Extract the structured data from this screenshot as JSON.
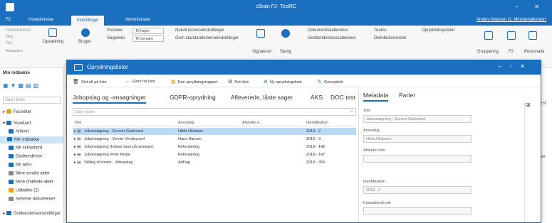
{
  "app": {
    "title": "cBrain F2- TestRC",
    "user": "Anders Madsen (1. Ministerialkontor)"
  },
  "menubar": [
    "F2",
    "Hovedvindue",
    "Indstillinger",
    "Administrator"
  ],
  "ribbon": {
    "left_items": [
      "Hovedvindue",
      "Skp.",
      "Akt."
    ],
    "navigation_label": "Navigation",
    "buttons": [
      "Opsætning",
      "Bruger"
    ],
    "preview_label": "Preview:",
    "preview_value": "Til højre",
    "search_label": "Søgeliste:",
    "search_value": "Til venstre",
    "options": [
      "Nulstil kolonneindstillinger",
      "Gem standardkolonneindstillinger"
    ],
    "signatures": "Signaturer",
    "language": "Sprog",
    "dokument": [
      "Dokumentskabeloner",
      "Godkendelsesskabeloner"
    ],
    "teams": [
      "Teams",
      "Distributionslister"
    ],
    "opr": "Opryddningslister",
    "right": [
      "Gruppering",
      "F2",
      "Personalia"
    ]
  },
  "sidebar": {
    "top": "Min indbakke",
    "search_placeholder": "Søg i lister",
    "favorites": "Favoritter",
    "standard": "Standard",
    "items": [
      "Arkivet",
      "Min indbakke",
      "Mit skrivebord",
      "Godkendelser",
      "Mit arkiv",
      "Mine sendte akter",
      "Mine chattede akter",
      "Udbakke (1)",
      "Seneste dokumenter"
    ],
    "last": "Godkendelseshandlinger"
  },
  "modal": {
    "title": "Oprydningslister",
    "toolbar": [
      "Slet alt på liste",
      "Fjern fra liste",
      "Dan oprydningsrapport",
      "Ret liste",
      "Ny oprydningsliste",
      "Genoptrisk"
    ],
    "tabs": [
      "Jobopslag og -ansøgninger",
      "GDPR-oprydning",
      "Afleverede, låste sager",
      "AKS",
      "DOC test"
    ],
    "search_placeholder": "Søg i listen",
    "columns": [
      "Titel",
      "Ansvarlig",
      "Afsluttet d.",
      "Identifikation"
    ],
    "rows": [
      {
        "title": "Jobansøgning - Gunvor Gudmund",
        "owner": "Hilda Hildasen",
        "closed": "",
        "id": "2019 - 2"
      },
      {
        "title": "Jobansøgning - Verner Vendsyssel",
        "owner": "Hans Hansen",
        "closed": "",
        "id": "2019 - 3"
      },
      {
        "title": "Jobansøgning (Indsat navn på ansøger)",
        "owner": "Rekruttering",
        "closed": "",
        "id": "2019 - 142"
      },
      {
        "title": "Jobansøgning Peter Pedal",
        "owner": "Rekruttering",
        "closed": "",
        "id": "2019 - 147"
      },
      {
        "title": "Stilling til kontor - Jobopslag",
        "owner": "AdDep",
        "closed": "",
        "id": "2019 - 356"
      }
    ],
    "right_tabs": [
      "Metadata",
      "Parter"
    ],
    "fields": [
      {
        "label": "Titel",
        "value": "Jobansøgning - Gunvor Gudmund"
      },
      {
        "label": "Ansvarlig",
        "value": "Hilda Hildasen"
      },
      {
        "label": "Afsluttet den",
        "value": ""
      },
      {
        "label": "Identifikation",
        "value": "2019 - 2"
      },
      {
        "label": "Kassationskode",
        "value": ""
      }
    ]
  },
  "bg": {
    "right_text": "Test",
    "right_text2": "ager"
  },
  "colors": {
    "accent": "#1a6fbf",
    "selected_row": "#bcd9f5"
  }
}
